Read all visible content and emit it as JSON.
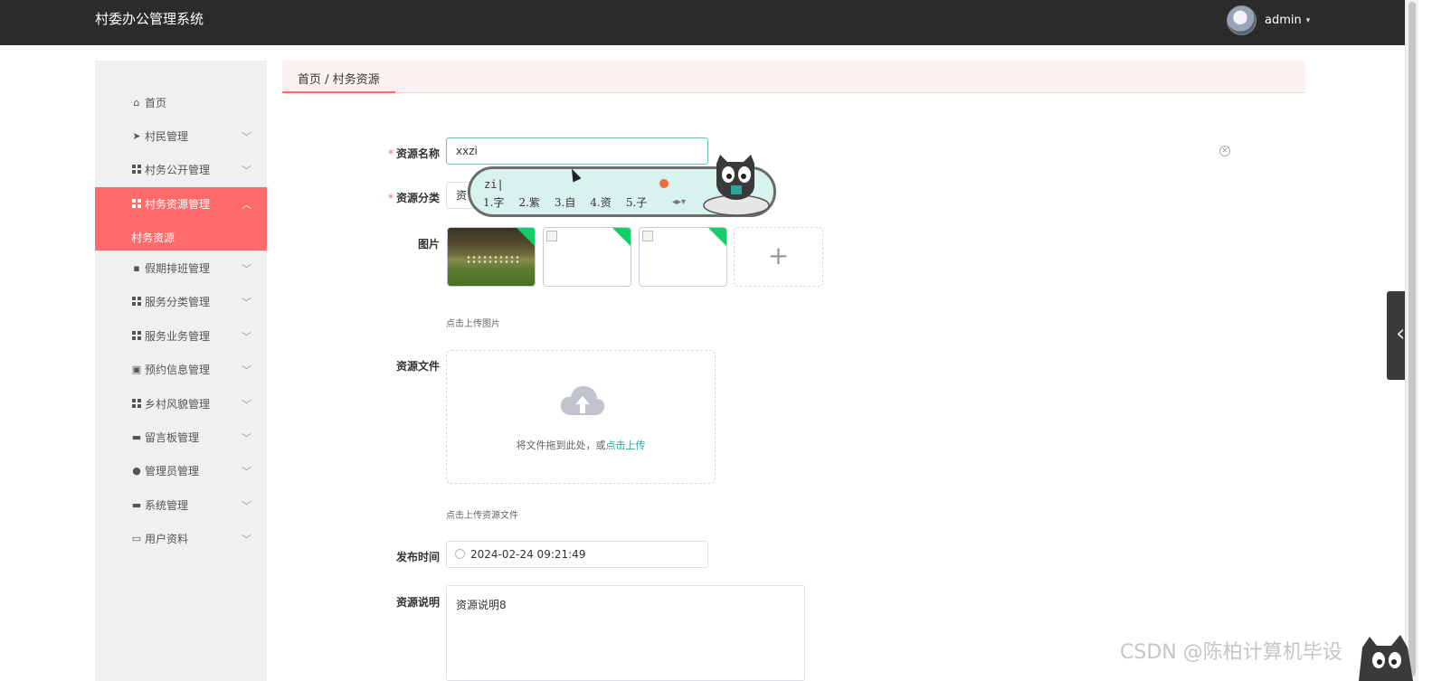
{
  "app": {
    "title": "村委办公管理系统",
    "user": "admin",
    "caret": "▾"
  },
  "sidebar": {
    "items": [
      {
        "label": "首页",
        "icon": "home-icon"
      },
      {
        "label": "村民管理",
        "icon": "send-icon"
      },
      {
        "label": "村务公开管理",
        "icon": "grid-icon"
      },
      {
        "label": "村务资源管理",
        "icon": "grid-icon",
        "active": true
      },
      {
        "label": "假期排班管理",
        "icon": "chat-icon"
      },
      {
        "label": "服务分类管理",
        "icon": "grid-icon"
      },
      {
        "label": "服务业务管理",
        "icon": "grid-icon"
      },
      {
        "label": "预约信息管理",
        "icon": "clipboard-icon"
      },
      {
        "label": "乡村风貌管理",
        "icon": "grid-icon"
      },
      {
        "label": "留言板管理",
        "icon": "message-icon"
      },
      {
        "label": "管理员管理",
        "icon": "user-icon"
      },
      {
        "label": "系统管理",
        "icon": "monitor-icon"
      },
      {
        "label": "用户资料",
        "icon": "card-icon"
      }
    ],
    "submenu_label": "村务资源"
  },
  "breadcrumb": {
    "text": "首页 / 村务资源"
  },
  "form": {
    "name_label": "资源名称",
    "name_value": "xxzi",
    "category_label": "资源分类",
    "category_value": "资",
    "image_label": "图片",
    "image_hint": "点击上传图片",
    "file_label": "资源文件",
    "file_drop_text": "将文件拖到此处，或",
    "file_drop_link": "点击上传",
    "file_hint": "点击上传资源文件",
    "time_label": "发布时间",
    "time_value": "2024-02-24 09:21:49",
    "desc_label": "资源说明",
    "desc_value": "资源说明8",
    "add_symbol": "+",
    "required_mark": "*"
  },
  "ime": {
    "pinyin": "zi|",
    "candidates": [
      "1.字",
      "2.紫",
      "3.自",
      "4.资",
      "5.子"
    ],
    "nav": "◂▸▾"
  },
  "watermark": "CSDN @陈柏计算机毕设",
  "colors": {
    "accent": "#ff6b6b",
    "topbar": "#2b2b2b",
    "success": "#13ce66",
    "link": "#2aa69a"
  }
}
